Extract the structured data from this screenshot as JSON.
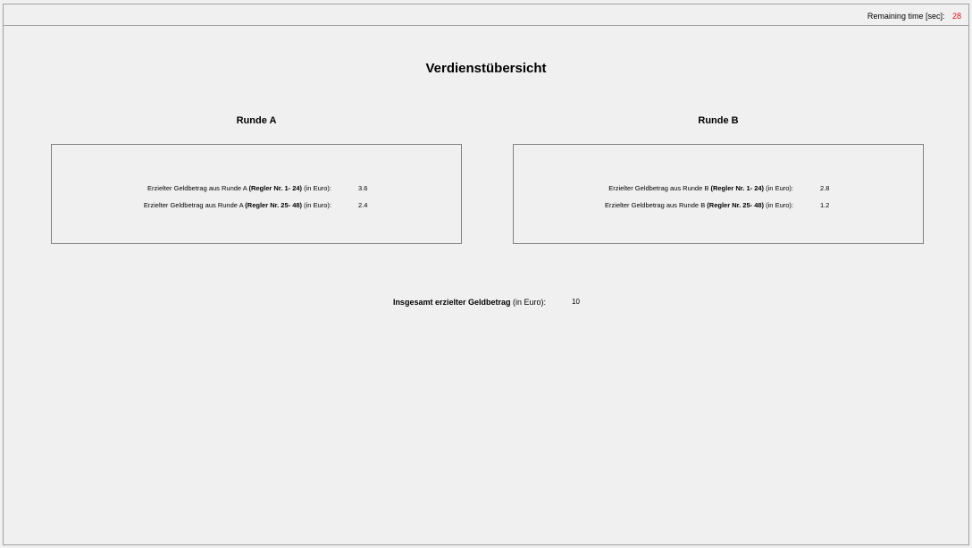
{
  "header": {
    "remaining_label": "Remaining time [sec]:",
    "remaining_value": "28"
  },
  "title": "Verdienstübersicht",
  "rounds": [
    {
      "heading": "Runde A",
      "rows": [
        {
          "prefix": "Erzielter Geldbetrag aus Runde A ",
          "bold": "(Regler Nr. 1- 24)",
          "suffix": " (in Euro):",
          "value": "3.6"
        },
        {
          "prefix": "Erzielter Geldbetrag aus Runde A ",
          "bold": "(Regler Nr. 25- 48)",
          "suffix": " (in Euro):",
          "value": "2.4"
        }
      ]
    },
    {
      "heading": "Runde B",
      "rows": [
        {
          "prefix": "Erzielter Geldbetrag aus Runde B ",
          "bold": "(Regler Nr. 1- 24)",
          "suffix": " (in Euro):",
          "value": "2.8"
        },
        {
          "prefix": "Erzielter Geldbetrag aus Runde B ",
          "bold": "(Regler Nr. 25- 48)",
          "suffix": " (in Euro):",
          "value": "1.2"
        }
      ]
    }
  ],
  "total": {
    "bold": "Insgesamt erzielter Geldbetrag",
    "suffix": " (in Euro):",
    "value": "10"
  },
  "colors": {
    "timer_value": "#e01010",
    "background": "#f0f0f0",
    "border": "#808080"
  }
}
